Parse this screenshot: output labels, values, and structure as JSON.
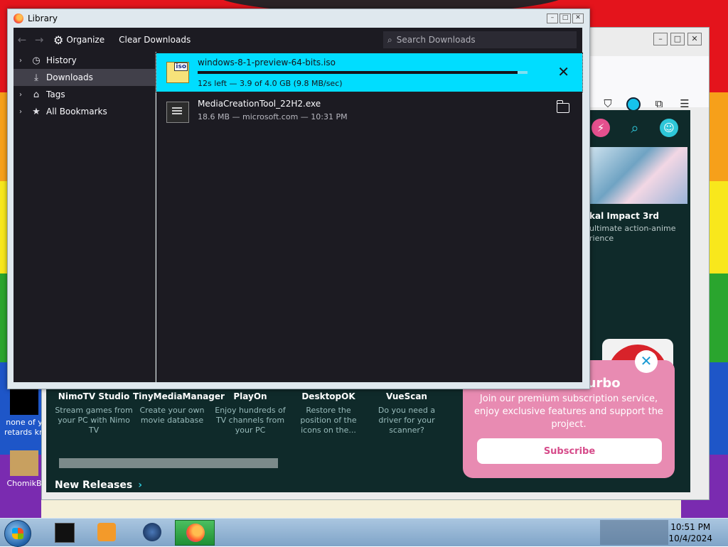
{
  "library": {
    "title": "Library",
    "organize_label": "Organize",
    "clear_downloads_label": "Clear Downloads",
    "search_placeholder": "Search Downloads",
    "sidebar": [
      {
        "label": "History",
        "icon": "clock-icon",
        "selected": false
      },
      {
        "label": "Downloads",
        "icon": "download-icon",
        "selected": true
      },
      {
        "label": "Tags",
        "icon": "tag-icon",
        "selected": false
      },
      {
        "label": "All Bookmarks",
        "icon": "star-icon",
        "selected": false
      }
    ],
    "downloads": [
      {
        "name": "windows-8-1-preview-64-bits.iso",
        "status": "12s left — 3.9 of 4.0 GB (9.8 MB/sec)",
        "progress": 0.97,
        "state": "in-progress",
        "badge": "iso"
      },
      {
        "name": "MediaCreationTool_22H2.exe",
        "status": "18.6 MB — microsoft.com — 10:31 PM",
        "state": "completed"
      }
    ]
  },
  "store": {
    "game_title": "kal Impact 3rd",
    "game_desc": "ultimate action-anime rience",
    "apps": [
      {
        "name": "NimoTV Studio",
        "desc": "Stream games from your PC with Nimo TV"
      },
      {
        "name": "TinyMediaManager",
        "desc": "Create your own movie database"
      },
      {
        "name": "PlayOn",
        "desc": "Enjoy hundreds of TV channels from your PC"
      },
      {
        "name": "DesktopOK",
        "desc": "Restore the position of the icons on the..."
      },
      {
        "name": "VueScan",
        "desc": "Do you need a driver for your scanner?"
      }
    ],
    "new_releases": "New Releases",
    "turbo_title": "Turbo",
    "turbo_text": "Join our premium subscription service, enjoy exclusive features and support the project.",
    "subscribe_label": "Subscribe"
  },
  "desktop": {
    "icon1_label": "none of y retards kn",
    "icon2_label": "ChomikB"
  },
  "taskbar": {
    "time": "10:51 PM",
    "date": "10/4/2024"
  },
  "colors": {
    "accent": "#00ddff",
    "dark_bg": "#1c1b22",
    "turbo_pink": "#e88bb2"
  }
}
